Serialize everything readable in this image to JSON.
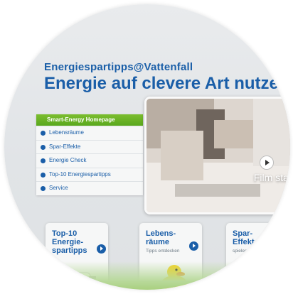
{
  "header": {
    "eyebrow": "Energiespartipps@Vattenfall",
    "headline": "Energie auf clevere Art nutze"
  },
  "menu": {
    "header": "Smart-Energy Homepage",
    "items": [
      {
        "label": "Lebensräume"
      },
      {
        "label": "Spar-Effekte"
      },
      {
        "label": "Energie Check"
      },
      {
        "label": "Top-10 Energiespartipps"
      },
      {
        "label": "Service"
      }
    ]
  },
  "video": {
    "cta": "Film starten",
    "icon": "play-icon"
  },
  "cards": [
    {
      "title": "Top-10 Energie-spartipps",
      "sub": ""
    },
    {
      "title": "Lebens-räume",
      "sub": "Tipps entdecken"
    },
    {
      "title": "Spar-Effekte",
      "sub": "spielend l"
    }
  ],
  "colors": {
    "brand_blue": "#1a5ea8",
    "accent_green": "#5aa81d"
  }
}
